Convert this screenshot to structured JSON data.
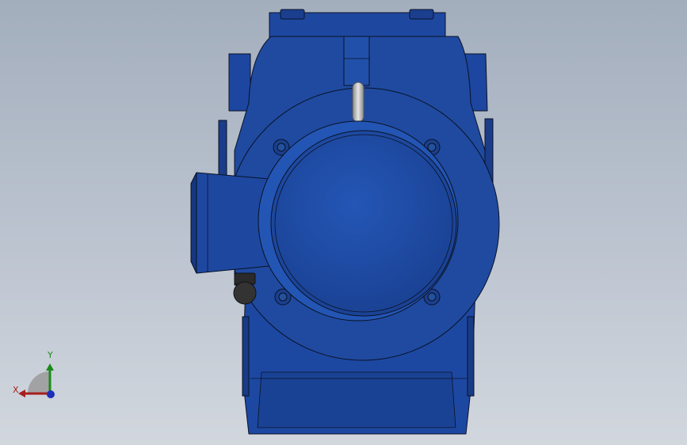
{
  "viewport": {
    "model_name": "gear-motor",
    "view": "front",
    "colors": {
      "background_top": "#a3aebd",
      "background_bottom": "#d2d7de",
      "body": "#1f4aa0",
      "body_dark": "#173a82",
      "body_light": "#2c5cc0",
      "edge": "#0a1226",
      "hardware": "#2a2a2a",
      "lifting_eye": "#bcbcbc"
    }
  },
  "triad": {
    "x_label": "X",
    "y_label": "Y",
    "x_color": "#a61e1e",
    "y_color": "#1a8a1a",
    "z_color": "#1c2fb8"
  }
}
